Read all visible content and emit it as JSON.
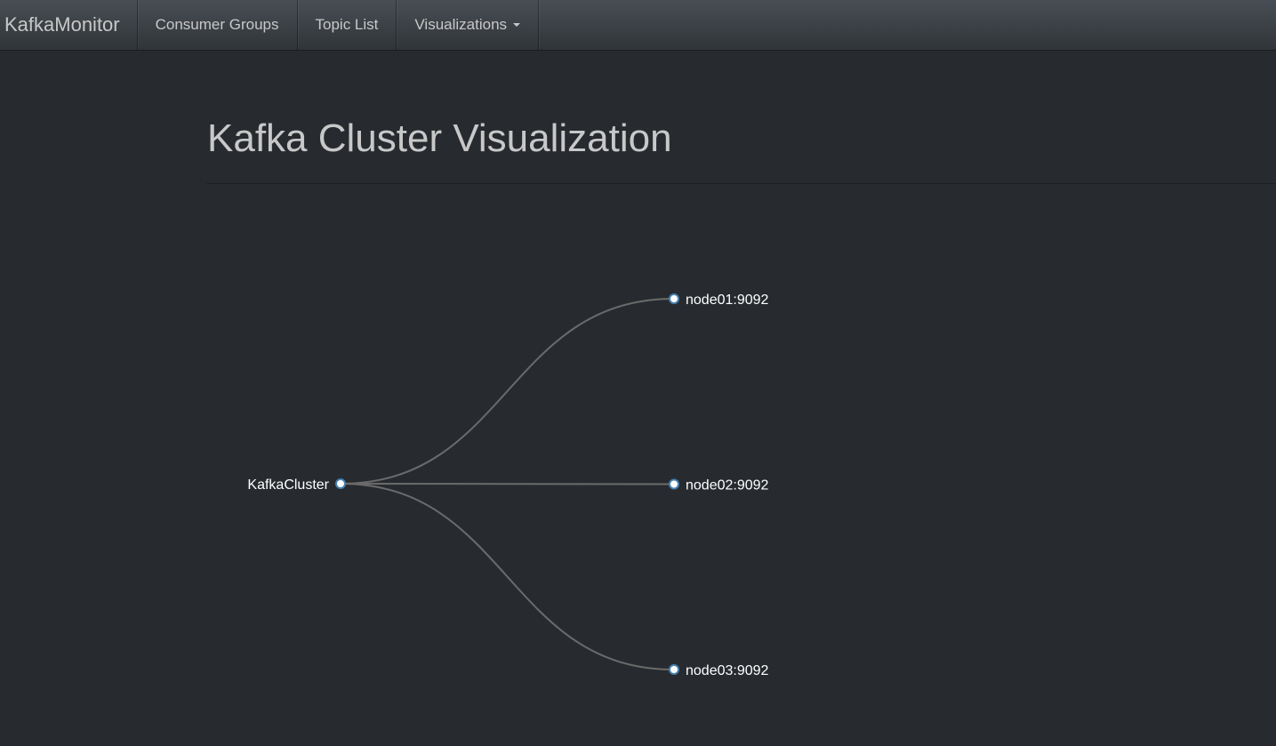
{
  "navbar": {
    "brand": "KafkaMonitor",
    "items": [
      {
        "label": "Consumer Groups"
      },
      {
        "label": "Topic List"
      },
      {
        "label": "Visualizations"
      }
    ]
  },
  "page": {
    "title": "Kafka Cluster Visualization"
  },
  "tree": {
    "root": "KafkaCluster",
    "children": [
      "node01:9092",
      "node02:9092",
      "node03:9092"
    ]
  },
  "colors": {
    "background": "#272b30",
    "link": "#6b6b6b",
    "node_fill": "#ffffff",
    "node_stroke": "#4682b4"
  }
}
